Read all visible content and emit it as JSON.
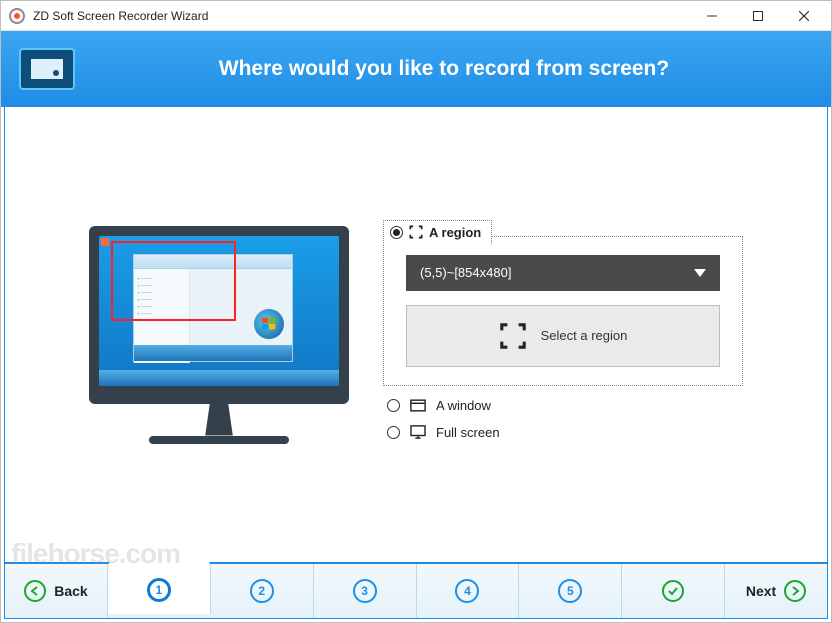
{
  "window": {
    "title": "ZD Soft Screen Recorder Wizard"
  },
  "banner": {
    "title": "Where would you like to record from screen?"
  },
  "options": {
    "region": {
      "label": "A region",
      "combo_value": "(5,5)~[854x480]",
      "select_label": "Select a region"
    },
    "window_opt": {
      "label": "A window"
    },
    "fullscreen": {
      "label": "Full screen"
    }
  },
  "steps": {
    "back": "Back",
    "next": "Next",
    "s1": "1",
    "s2": "2",
    "s3": "3",
    "s4": "4",
    "s5": "5"
  },
  "watermark": "filehorse.com"
}
